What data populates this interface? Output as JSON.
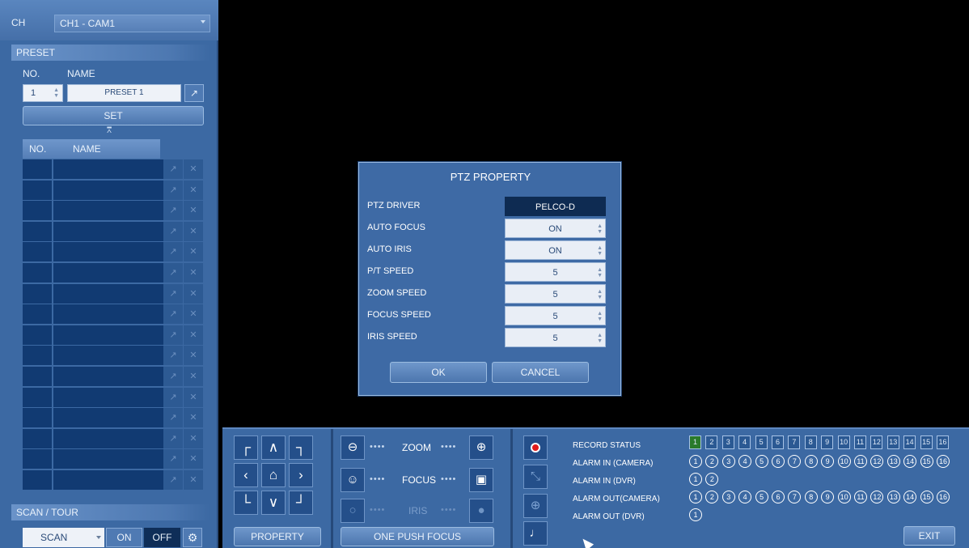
{
  "channel": {
    "label": "CH",
    "selected": "CH1 - CAM1"
  },
  "preset": {
    "section_title": "PRESET",
    "no_label": "NO.",
    "name_label": "NAME",
    "number_value": "1",
    "name_value": "PRESET 1",
    "set_label": "SET",
    "list_headers": {
      "no": "NO.",
      "name": "NAME"
    },
    "list_rows": 16
  },
  "scan_tour": {
    "section_title": "SCAN / TOUR",
    "mode_value": "SCAN",
    "on_label": "ON",
    "off_label": "OFF"
  },
  "controls": {
    "property_label": "PROPERTY",
    "zoom_label": "ZOOM",
    "focus_label": "FOCUS",
    "iris_label": "IRIS",
    "one_push_focus_label": "ONE PUSH FOCUS"
  },
  "status": {
    "record_status_label": "RECORD STATUS",
    "alarm_in_camera_label": "ALARM IN (CAMERA)",
    "alarm_in_dvr_label": "ALARM IN (DVR)",
    "alarm_out_camera_label": "ALARM OUT(CAMERA)",
    "alarm_out_dvr_label": "ALARM OUT (DVR)",
    "record_channels": [
      "1",
      "2",
      "3",
      "4",
      "5",
      "6",
      "7",
      "8",
      "9",
      "10",
      "11",
      "12",
      "13",
      "14",
      "15",
      "16"
    ],
    "record_active_channel": "1",
    "alarm_in_camera": [
      "1",
      "2",
      "3",
      "4",
      "5",
      "6",
      "7",
      "8",
      "9",
      "10",
      "11",
      "12",
      "13",
      "14",
      "15",
      "16"
    ],
    "alarm_in_dvr": [
      "1",
      "2"
    ],
    "alarm_out_camera": [
      "1",
      "2",
      "3",
      "4",
      "5",
      "6",
      "7",
      "8",
      "9",
      "10",
      "11",
      "12",
      "13",
      "14",
      "15",
      "16"
    ],
    "alarm_out_dvr": [
      "1"
    ],
    "exit_label": "EXIT"
  },
  "dialog": {
    "title": "PTZ PROPERTY",
    "rows": [
      {
        "key": "PTZ DRIVER",
        "value": "PELCO-D"
      },
      {
        "key": "AUTO FOCUS",
        "value": "ON"
      },
      {
        "key": "AUTO IRIS",
        "value": "ON"
      },
      {
        "key": "P/T SPEED",
        "value": "5"
      },
      {
        "key": "ZOOM SPEED",
        "value": "5"
      },
      {
        "key": "FOCUS SPEED",
        "value": "5"
      },
      {
        "key": "IRIS SPEED",
        "value": "5"
      }
    ],
    "ok_label": "OK",
    "cancel_label": "CANCEL"
  },
  "colors": {
    "panel": "#3c69a3",
    "dark_cell": "#113a72",
    "record_active": "#2a7a2a",
    "record_button": "#e01a1a"
  }
}
